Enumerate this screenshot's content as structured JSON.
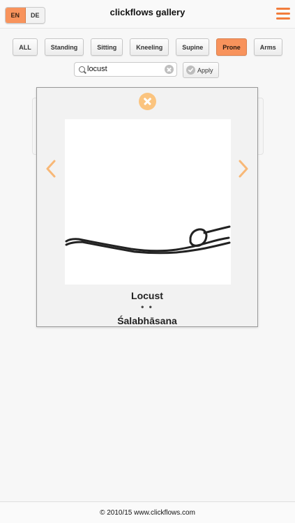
{
  "header": {
    "title": "clickflows gallery",
    "lang": {
      "en": "EN",
      "de": "DE",
      "active": "EN"
    }
  },
  "filters": {
    "items": [
      "ALL",
      "Standing",
      "Sitting",
      "Kneeling",
      "Supine",
      "Prone",
      "Arms"
    ],
    "selected": "Prone"
  },
  "search": {
    "value": "locust"
  },
  "apply_label": "Apply",
  "modal": {
    "pose_name": "Locust",
    "separator": "• •",
    "sanskrit_name": "Śalabhāsana"
  },
  "footer": {
    "text": "© 2010/15 www.clickflows.com"
  },
  "colors": {
    "accent": "#f8935c",
    "close": "#fbc47f",
    "nav_arrow": "#f8b877",
    "menu": "#f27d3c"
  }
}
